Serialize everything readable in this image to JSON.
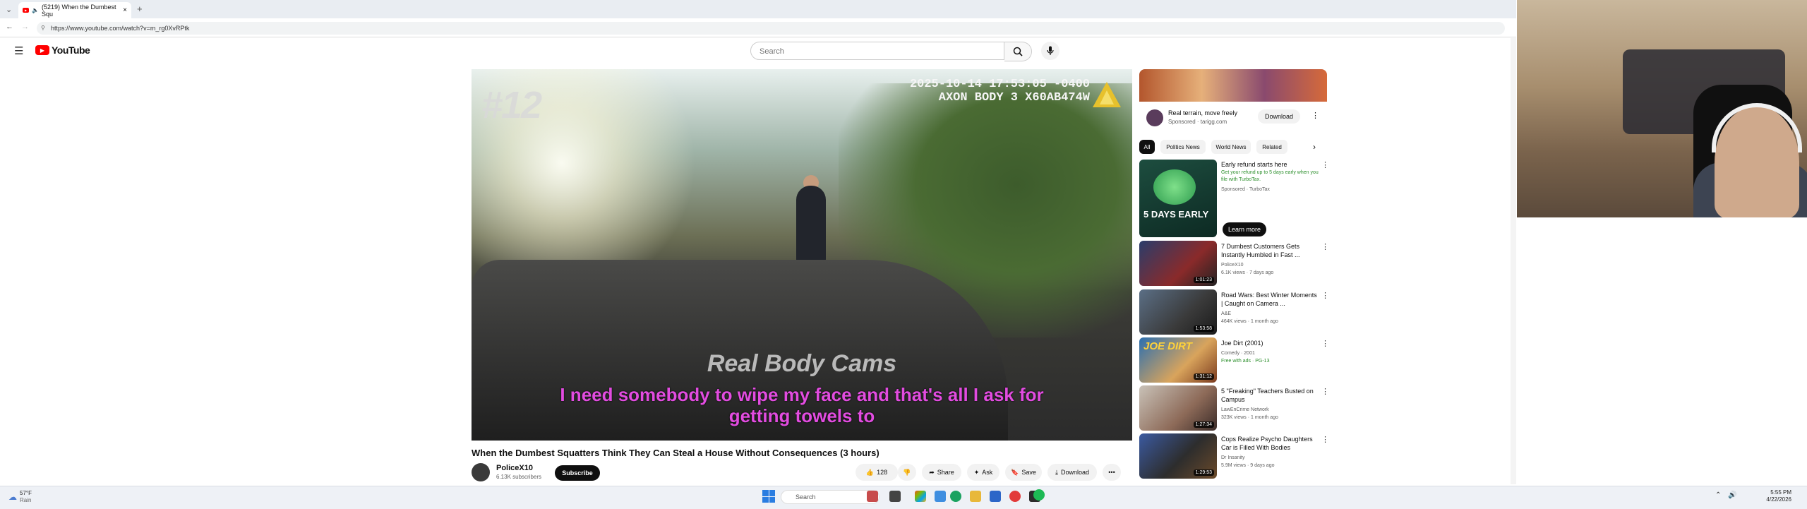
{
  "browser": {
    "tab_title": "(5219) When the Dumbest Squ",
    "tab_close": "×",
    "new_tab": "+",
    "url": "https://www.youtube.com/watch?v=m_rg0XvRPtk",
    "back": "←",
    "forward": "→"
  },
  "header": {
    "logo_text": "YouTube",
    "search_placeholder": "Search"
  },
  "video": {
    "overlay_number": "#12",
    "timestamp_line1": "2025-10-14 17:53:05 -0400",
    "timestamp_line2": "AXON BODY 3 X60AB474W",
    "watermark": "Real Body Cams",
    "caption_line1": "I need somebody to wipe my face and that's all I ask for",
    "caption_line2": "getting towels to",
    "title": "When the Dumbest Squatters Think They Can Steal a House Without Consequences (3 hours)"
  },
  "channel": {
    "name": "PoliceX10",
    "subscribers": "6.13K subscribers",
    "subscribe_label": "Subscribe"
  },
  "actions": {
    "likes": "128",
    "share": "Share",
    "ask": "Ask",
    "save": "Save",
    "download": "Download",
    "more": "•••"
  },
  "sidebar": {
    "ad": {
      "title": "Real terrain, move freely",
      "sponsor": "Sponsored · tarigg.com",
      "download": "Download"
    },
    "chips": [
      "All",
      "Politics News",
      "World News",
      "Related"
    ],
    "promo": {
      "title": "Early refund starts here",
      "desc": "Get your refund up to 5 days early when you file with TurboTax.",
      "sponsored": "Sponsored · TurboTax",
      "cta": "Learn more",
      "thumb_text": "5 DAYS EARLY"
    },
    "items": [
      {
        "title": "7 Dumbest Customers Gets Instantly Humbled in Fast ...",
        "channel": "PoliceX10",
        "meta": "6.1K views · 7 days ago",
        "duration": "1:01:23"
      },
      {
        "title": "Road Wars: Best Winter Moments | Caught on Camera ...",
        "channel": "A&E",
        "meta": "464K views · 1 month ago",
        "duration": "1:53:58"
      },
      {
        "title": "Joe Dirt (2001)",
        "channel": "Comedy · 2001",
        "meta": "Free with ads · PG-13",
        "duration": "1:31:12",
        "thumb_text": "JOE DIRT"
      },
      {
        "title": "5 \"Freaking\" Teachers Busted on Campus",
        "channel": "LawEnCrime Network",
        "meta": "323K views · 1 month ago",
        "duration": "1:27:34"
      },
      {
        "title": "Cops Realize Psycho Daughters Car is Filled With Bodies",
        "channel": "Dr Insanity",
        "meta": "5.9M views · 9 days ago",
        "duration": "1:29:53"
      }
    ]
  },
  "taskbar": {
    "weather_temp": "57°F",
    "weather_desc": "Rain",
    "search": "Search",
    "time": "5:55 PM",
    "date": "4/22/2026"
  },
  "colors": {
    "youtube_red": "#ff0000",
    "caption_magenta": "#e24ce0"
  }
}
